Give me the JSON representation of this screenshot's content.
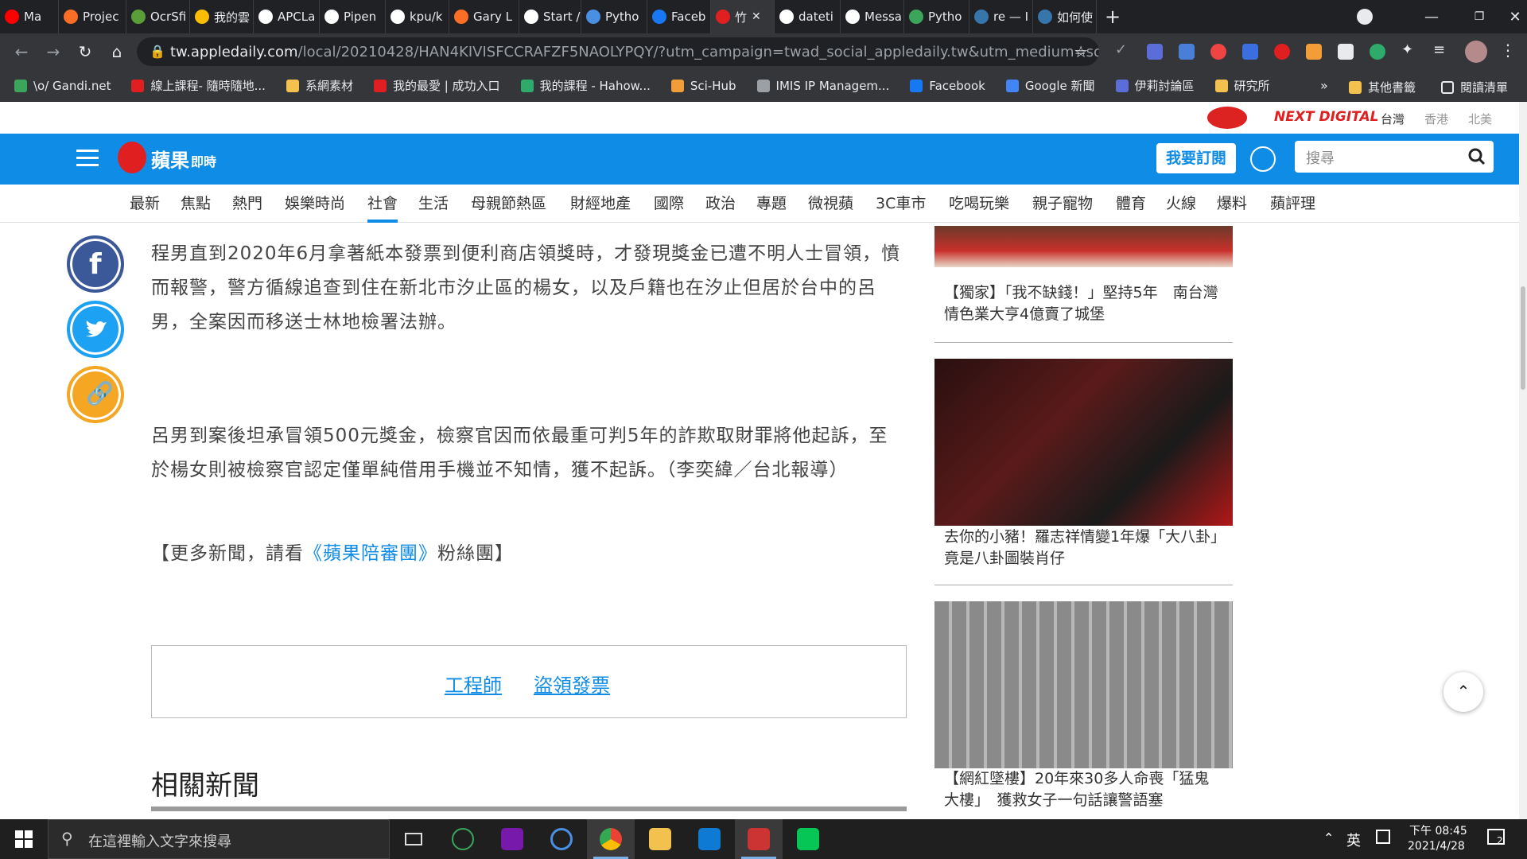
{
  "browser": {
    "tabs": [
      {
        "label": "Ma",
        "icon": "youtube-icon",
        "color": "#ff0000"
      },
      {
        "label": "Projec",
        "icon": "gitlab-icon",
        "color": "#fc6d26"
      },
      {
        "label": "OcrSfi",
        "icon": "leaf-icon",
        "color": "#5a9e3a"
      },
      {
        "label": "我的雲",
        "icon": "google-drive-icon",
        "color": "#fbbc04"
      },
      {
        "label": "APCLa",
        "icon": "github-icon",
        "color": "#ffffff"
      },
      {
        "label": "Pipen",
        "icon": "medium-icon",
        "color": "#ffffff"
      },
      {
        "label": "kpu/k",
        "icon": "github-icon",
        "color": "#ffffff"
      },
      {
        "label": "Gary L",
        "icon": "gitlab-icon",
        "color": "#fc6d26"
      },
      {
        "label": "Start /",
        "icon": "notion-icon",
        "color": "#ffffff"
      },
      {
        "label": "Pytho",
        "icon": "doc-icon",
        "color": "#4a90e2"
      },
      {
        "label": "Faceb",
        "icon": "facebook-icon",
        "color": "#1877f2"
      },
      {
        "label": "竹",
        "icon": "apple-daily-icon",
        "color": "#e02020"
      },
      {
        "label": "dateti",
        "icon": "google-icon",
        "color": "#ffffff"
      },
      {
        "label": "Messa",
        "icon": "google-icon",
        "color": "#ffffff"
      },
      {
        "label": "Pytho",
        "icon": "green-icon",
        "color": "#3ba55c"
      },
      {
        "label": "re — I",
        "icon": "python-icon",
        "color": "#3776ab"
      },
      {
        "label": "如何使",
        "icon": "python-icon",
        "color": "#3776ab"
      }
    ],
    "new_tab_label": "+",
    "url_host": "tw.appledaily.com",
    "url_rest": "/local/20210428/HAN4KIVISFCCRAFZF5NAOLYPQY/?utm_campaign=twad_social_appledaily.tw&utm_medium=soc...",
    "bookmarks": [
      {
        "label": "\\o/ Gandi.net",
        "color": "#3ba55c"
      },
      {
        "label": "線上課程- 隨時隨地...",
        "color": "#e02020"
      },
      {
        "label": "系網素材",
        "color": "#f2c14e"
      },
      {
        "label": "我的最愛 | 成功入口",
        "color": "#e02020"
      },
      {
        "label": "我的課程 - Hahow...",
        "color": "#2eaa6a"
      },
      {
        "label": "Sci-Hub",
        "color": "#f29d38"
      },
      {
        "label": "IMIS IP Managem...",
        "color": "#9aa0a6"
      },
      {
        "label": "Facebook",
        "color": "#1877f2"
      },
      {
        "label": "Google 新聞",
        "color": "#4285f4"
      },
      {
        "label": "伊莉討論區",
        "color": "#5a6dd8"
      },
      {
        "label": "研究所",
        "color": "#f2c14e"
      }
    ],
    "bookmarks_overflow": "»",
    "other_bookmarks": "其他書籤",
    "reading_list": "閱讀清單"
  },
  "site": {
    "top_links": {
      "brand1": "NEXT DIGITAL",
      "region_tw": "台灣",
      "region_hk": "香港",
      "region_na": "北美"
    },
    "logo_text": "蘋果",
    "logo_sub": "即時",
    "subscribe_label": "我要訂閱",
    "search_placeholder": "搜尋",
    "categories": [
      "最新",
      "焦點",
      "熱門",
      "娛樂時尚",
      "社會",
      "生活",
      "母親節熱區",
      "財經地產",
      "國際",
      "政治",
      "專題",
      "微視蘋",
      "3C車市",
      "吃喝玩樂",
      "親子寵物",
      "體育",
      "火線",
      "爆料",
      "蘋評理"
    ],
    "active_category": "社會"
  },
  "article": {
    "p1": "程男直到2020年6月拿著紙本發票到便利商店領獎時，才發現獎金已遭不明人士冒領，憤而報警，警方循線追查到住在新北市汐止區的楊女，以及戶籍也在汐止但居於台中的呂男，全案因而移送士林地檢署法辦。",
    "p2": "呂男到案後坦承冒領500元獎金，檢察官因而依最重可判5年的詐欺取財罪將他起訴，至於楊女則被檢察官認定僅單純借用手機並不知情，獲不起訴。（李奕緯／台北報導）",
    "p3_prefix": "【更多新聞，請看",
    "p3_link": "《蘋果陪審團》",
    "p3_suffix": "粉絲團】",
    "tags": [
      "工程師",
      "盜領發票"
    ],
    "related_heading": "相關新聞"
  },
  "sidebar": [
    {
      "caption": "【獨家】「我不缺錢！」堅持5年　南台灣情色業大亨4億賣了城堡"
    },
    {
      "caption": "去你的小豬！羅志祥情變1年爆「大八卦」　竟是八卦圖裝肖仔"
    },
    {
      "caption": "【網紅墜樓】20年來30多人命喪「猛鬼大樓」　獲救女子一句話讓警語塞"
    }
  ],
  "taskbar": {
    "search_placeholder": "在這裡輸入文字來搜尋",
    "ime": "英",
    "time": "下午 08:45",
    "date": "2021/4/28",
    "notif_count": "2"
  }
}
